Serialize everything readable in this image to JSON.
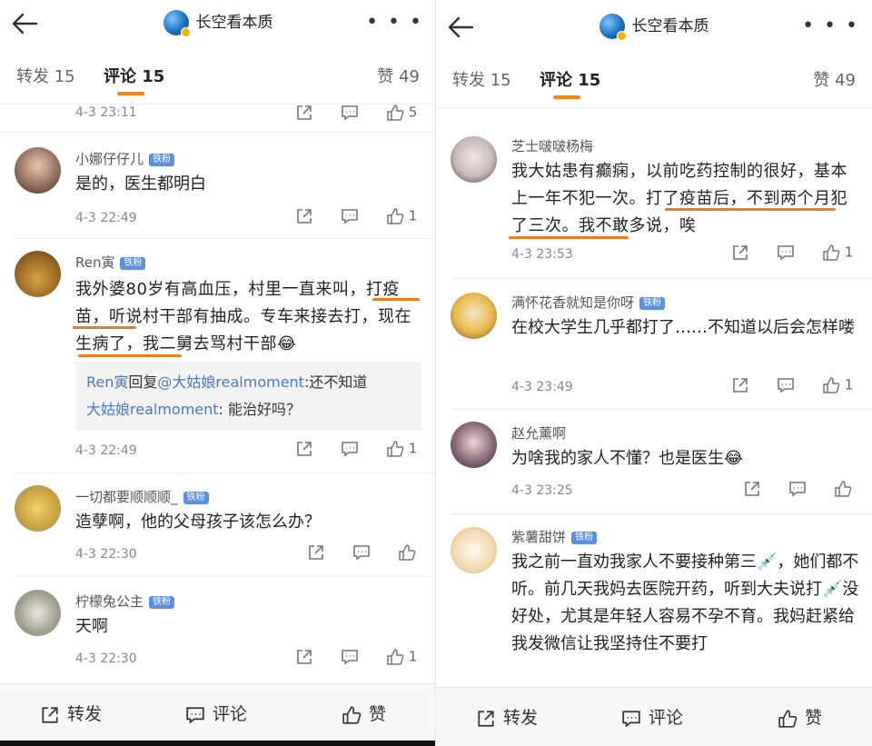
{
  "header": {
    "title": "长空看本质",
    "more": "• • •"
  },
  "tabs": {
    "repost": "转发 15",
    "comment": "评论 15",
    "like": "赞 49"
  },
  "badge": "铁粉",
  "left": {
    "top_row": {
      "time": "4-3 23:11",
      "likes": "5"
    },
    "comments": [
      {
        "name": "小娜仔仔儿",
        "text": "是的，医生都明白",
        "time": "4-3 22:49",
        "likes": "1"
      },
      {
        "name": "Ren寅",
        "text": "我外婆80岁有高血压，村里一直来叫，打疫苗，听说村干部有抽成。专车来接去打，现在生病了，我二舅去骂村干部😂",
        "reply": {
          "from": "Ren寅",
          "mid": "回复",
          "to": "@大姑娘realmoment",
          "msg": ":还不知道",
          "from2": "大姑娘realmoment",
          "msg2": ": 能治好吗？"
        },
        "time": "4-3 22:49",
        "likes": "1"
      },
      {
        "name": "一切都要顺顺顺_",
        "text": "造孽啊，他的父母孩子该怎么办？",
        "time": "4-3 22:30",
        "likes": ""
      },
      {
        "name": "柠檬兔公主",
        "text": "天啊",
        "time": "4-3 22:30",
        "likes": "1"
      }
    ]
  },
  "right": {
    "comments": [
      {
        "name": "芝士啵啵杨梅",
        "text": "我大姑患有癫痫，以前吃药控制的很好，基本上一年不犯一次。打了疫苗后，不到两个月犯了三次。我不敢多说，唉",
        "time": "4-3 23:53",
        "likes": "1"
      },
      {
        "name": "满怀花香就知是你呀",
        "text": "在校大学生几乎都打了……不知道以后会怎样喽",
        "time": "4-3 23:49",
        "likes": "1"
      },
      {
        "name": "赵允薰啊",
        "text": "为啥我的家人不懂？也是医生😂",
        "time": "4-3 23:25",
        "likes": ""
      },
      {
        "name": "紫薯甜饼",
        "text": "我之前一直劝我家人不要接种第三💉，她们都不听。前几天我妈去医院开药，听到大夫说打💉没好处，尤其是年轻人容易不孕不育。我妈赶紧给我发微信让我坚持住不要打",
        "time": "",
        "likes": ""
      }
    ]
  },
  "bottom": {
    "repost": "转发",
    "comment": "评论",
    "like": "赞"
  },
  "colors": {
    "accent": "#ff8200",
    "underline": "#f27a1a",
    "badge": "#5b8fe0",
    "link": "#4a78c2"
  }
}
